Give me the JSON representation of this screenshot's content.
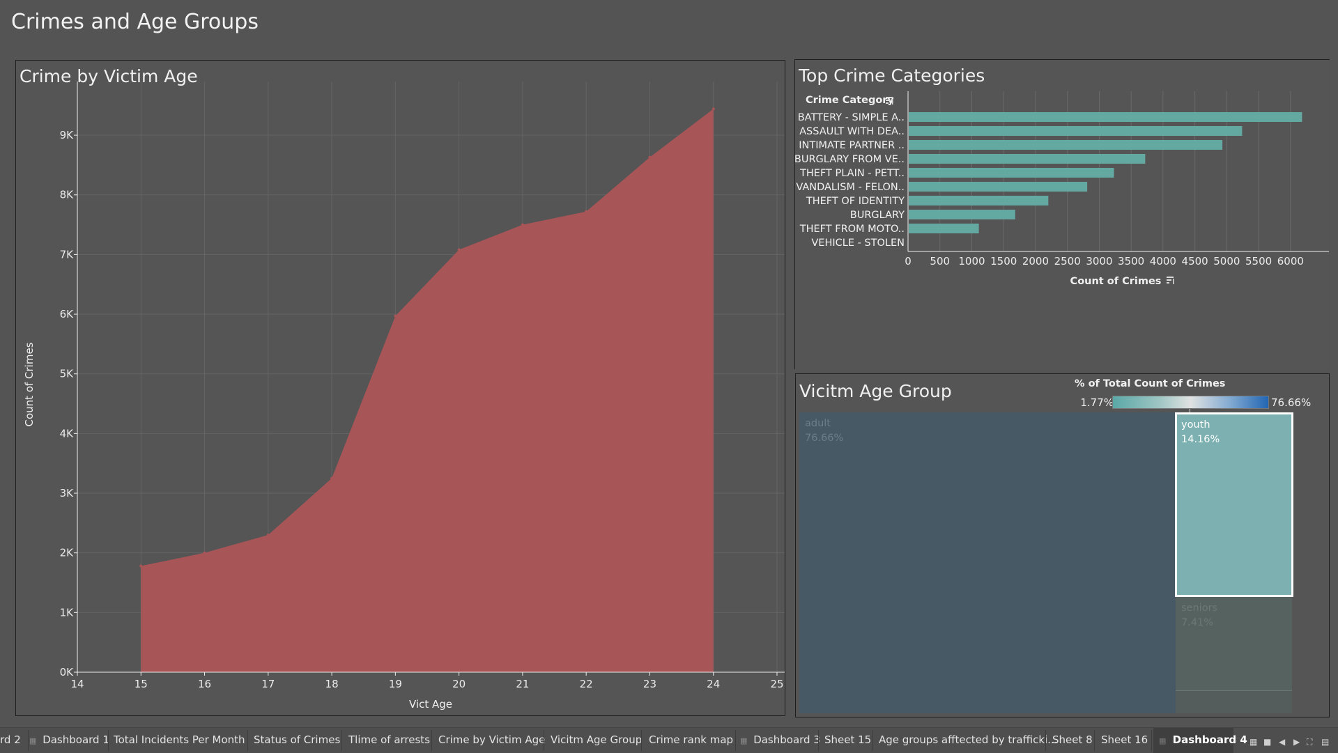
{
  "dashboard_title": "Crimes and Age Groups",
  "area_chart": {
    "title": "Crime by Victim Age",
    "xlabel": "Vict Age",
    "ylabel": "Count of Crimes",
    "color": "#a85558"
  },
  "bar_chart": {
    "title": "Top Crime Categories",
    "category_header": "Crime Category",
    "xlabel": "Count of Crimes",
    "color": "#64a8a2"
  },
  "treemap": {
    "title": "Vicitm Age Group",
    "legend": {
      "title": "% of Total Count of Crimes",
      "min_label": "1.77%",
      "max_label": "76.66%"
    },
    "cells": [
      {
        "name": "adult",
        "pct": "76.66%",
        "color": "#475965"
      },
      {
        "name": "youth",
        "pct": "14.16%",
        "color": "#7db0b1"
      },
      {
        "name": "seniors",
        "pct": "7.41%",
        "color": "#556260"
      }
    ]
  },
  "chart_data": [
    {
      "type": "area",
      "title": "Crime by Victim Age",
      "xlabel": "Vict Age",
      "ylabel": "Count of Crimes",
      "x": [
        15,
        16,
        17,
        18,
        19,
        20,
        21,
        22,
        23,
        24
      ],
      "values": [
        1780,
        2000,
        2300,
        3250,
        5970,
        7080,
        7500,
        7720,
        8630,
        9440
      ],
      "xlim": [
        14,
        25
      ],
      "ylim": [
        0,
        9900
      ],
      "x_ticks": [
        "14",
        "15",
        "16",
        "17",
        "18",
        "19",
        "20",
        "21",
        "22",
        "23",
        "24",
        "25"
      ],
      "y_ticks": [
        0,
        1000,
        2000,
        3000,
        4000,
        5000,
        6000,
        7000,
        8000,
        9000
      ],
      "y_tick_labels": [
        "0K",
        "1K",
        "2K",
        "3K",
        "4K",
        "5K",
        "6K",
        "7K",
        "8K",
        "9K"
      ],
      "grid": true
    },
    {
      "type": "bar",
      "orientation": "horizontal",
      "title": "Top Crime Categories",
      "categories": [
        "BATTERY - SIMPLE A..",
        "ASSAULT WITH DEA..",
        "INTIMATE PARTNER ..",
        "BURGLARY FROM VE..",
        "THEFT PLAIN - PETT..",
        "VANDALISM - FELON..",
        "THEFT OF IDENTITY",
        "BURGLARY",
        "THEFT FROM MOTO..",
        "VEHICLE - STOLEN"
      ],
      "values": [
        6170,
        5230,
        4920,
        3710,
        3220,
        2800,
        2190,
        1670,
        1100,
        0
      ],
      "xlabel": "Count of Crimes",
      "xlim": [
        0,
        6450
      ],
      "x_ticks": [
        0,
        500,
        1000,
        1500,
        2000,
        2500,
        3000,
        3500,
        4000,
        4500,
        5000,
        5500,
        6000
      ],
      "grid": true
    }
  ],
  "tabs": [
    {
      "label": "rd 2"
    },
    {
      "label": "Dashboard 1"
    },
    {
      "label": "Total Incidents Per Month"
    },
    {
      "label": "Status of Crimes"
    },
    {
      "label": "Tlime of arrests"
    },
    {
      "label": "Crime by Victim Age"
    },
    {
      "label": "Vicitm Age Group"
    },
    {
      "label": "Crime rank map"
    },
    {
      "label": "Dashboard 3"
    },
    {
      "label": "Sheet 15"
    },
    {
      "label": "Age groups afftected by trafficki..."
    },
    {
      "label": "Sheet 8"
    },
    {
      "label": "Sheet 16"
    },
    {
      "label": "Dashboard 4"
    }
  ],
  "tab_controls": [
    {
      "icon": "grid-view-icon"
    },
    {
      "icon": "filmstrip-view-icon"
    },
    {
      "icon": "arrow-left-icon"
    },
    {
      "icon": "arrow-right-icon"
    },
    {
      "icon": "fullscreen-icon"
    },
    {
      "icon": "presentation-mode-icon"
    }
  ]
}
